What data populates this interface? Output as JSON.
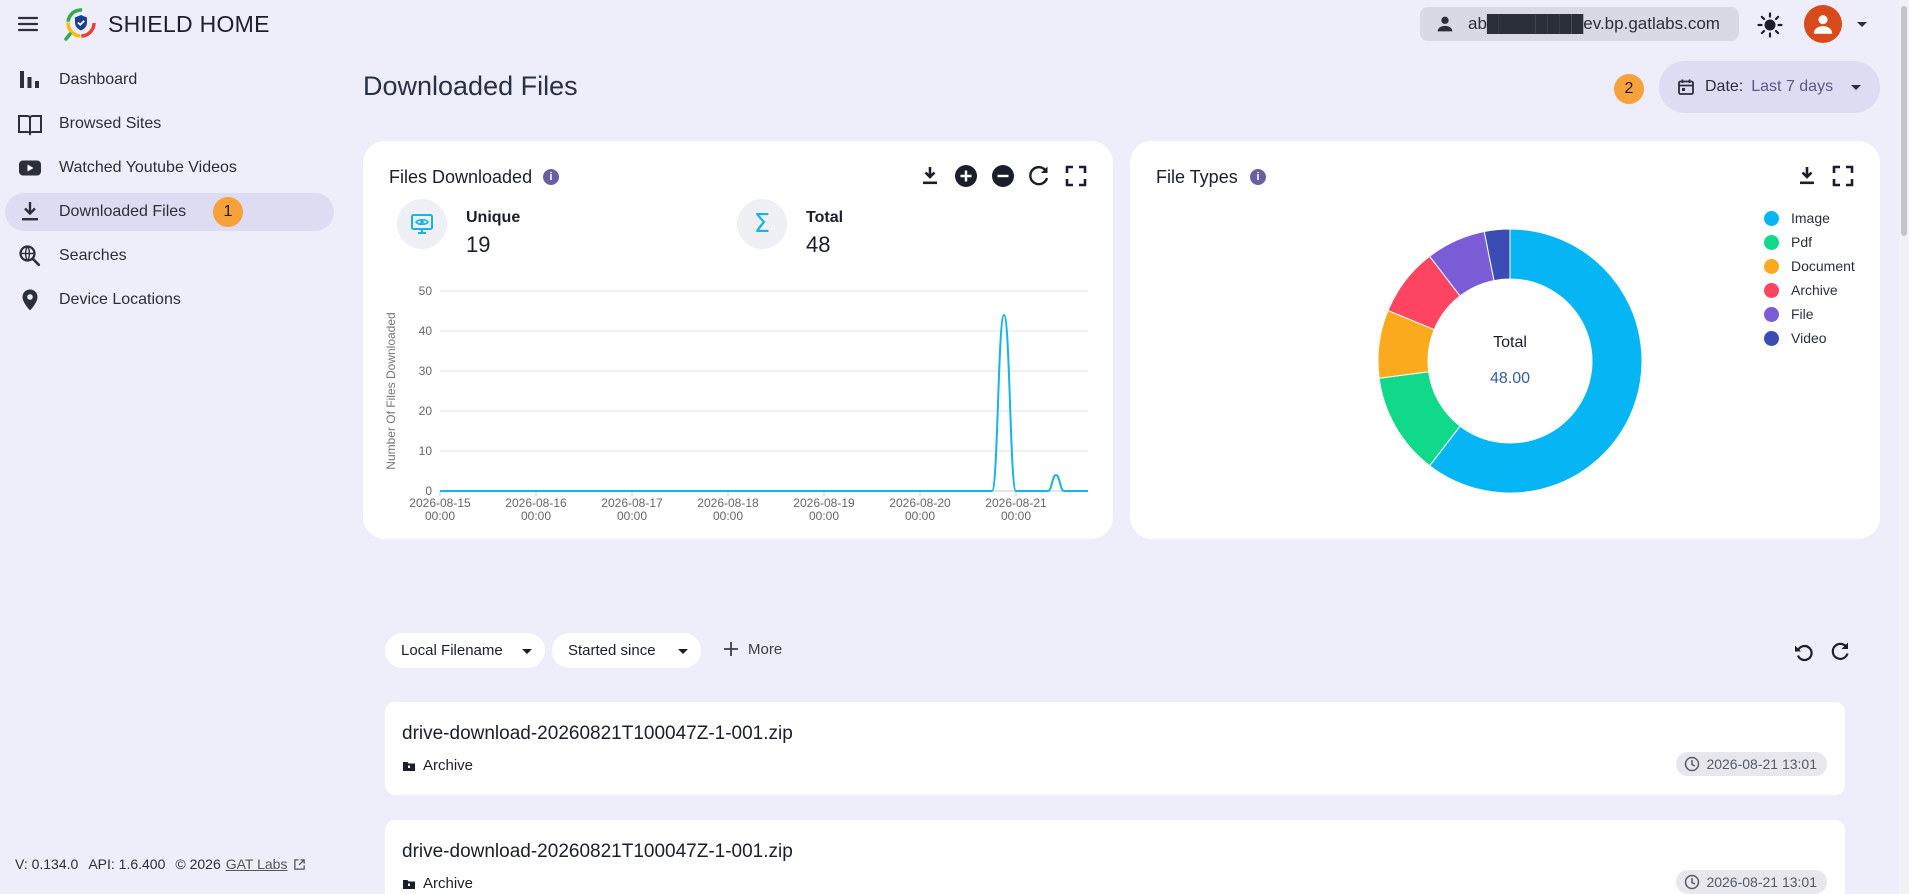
{
  "app": {
    "title": "SHIELD HOME",
    "user_email": "ab████████ev.bp.gatlabs.com"
  },
  "sidebar": {
    "items": [
      {
        "label": "Dashboard",
        "icon": "bar-chart-icon"
      },
      {
        "label": "Browsed Sites",
        "icon": "book-open-icon"
      },
      {
        "label": "Watched Youtube Videos",
        "icon": "youtube-icon"
      },
      {
        "label": "Downloaded Files",
        "icon": "download-icon",
        "active": true,
        "badge": "1"
      },
      {
        "label": "Searches",
        "icon": "search-globe-icon"
      },
      {
        "label": "Device Locations",
        "icon": "location-pin-icon"
      }
    ],
    "footer": {
      "version": "V: 0.134.0",
      "api": "API: 1.6.400",
      "copyright": "© 2026",
      "company_link": "GAT Labs"
    }
  },
  "page": {
    "title": "Downloaded Files",
    "date_filter": {
      "badge": "2",
      "label": "Date:",
      "value": "Last 7 days"
    }
  },
  "files_card": {
    "title": "Files Downloaded",
    "info": "i",
    "stats": {
      "unique_label": "Unique",
      "unique_value": "19",
      "total_label": "Total",
      "total_value": "48"
    }
  },
  "types_card": {
    "title": "File Types",
    "info": "i",
    "center_label": "Total",
    "center_value": "48.00"
  },
  "chart_data": [
    {
      "type": "line",
      "ylabel": "Number Of Files Downloaded",
      "xlabel": "",
      "ylim": [
        0,
        50
      ],
      "yticks": [
        0,
        10,
        20,
        30,
        40,
        50
      ],
      "xticks": [
        {
          "date": "2026-08-15",
          "time": "00:00"
        },
        {
          "date": "2026-08-16",
          "time": "00:00"
        },
        {
          "date": "2026-08-17",
          "time": "00:00"
        },
        {
          "date": "2026-08-18",
          "time": "00:00"
        },
        {
          "date": "2026-08-19",
          "time": "00:00"
        },
        {
          "date": "2026-08-20",
          "time": "00:00"
        },
        {
          "date": "2026-08-21",
          "time": "00:00"
        }
      ],
      "grid": true,
      "color": "#17b4ea",
      "points": [
        {
          "x": "2026-08-15 00:00",
          "y": 0
        },
        {
          "x": "2026-08-20 18:00",
          "y": 0
        },
        {
          "x": "2026-08-20 21:00",
          "y": 44
        },
        {
          "x": "2026-08-21 00:00",
          "y": 0
        },
        {
          "x": "2026-08-21 08:00",
          "y": 0
        },
        {
          "x": "2026-08-21 10:00",
          "y": 4
        },
        {
          "x": "2026-08-21 12:00",
          "y": 0
        },
        {
          "x": "2026-08-21 18:00",
          "y": 0
        }
      ]
    },
    {
      "type": "pie",
      "donut": true,
      "legend": "top-right",
      "slices": [
        {
          "label": "Image",
          "value": 29,
          "color": "#06b6f4"
        },
        {
          "label": "Pdf",
          "value": 6,
          "color": "#10d98a"
        },
        {
          "label": "Document",
          "value": 4,
          "color": "#fbaa1e"
        },
        {
          "label": "Archive",
          "value": 4,
          "color": "#fd4562"
        },
        {
          "label": "File",
          "value": 3.5,
          "color": "#7a5cd6"
        },
        {
          "label": "Video",
          "value": 1.5,
          "color": "#3b4db5"
        }
      ]
    }
  ],
  "filters": {
    "chips": [
      {
        "label": "Local Filename"
      },
      {
        "label": "Started since"
      }
    ],
    "more_label": "More"
  },
  "results": [
    {
      "filename": "drive-download-20260821T100047Z-1-001.zip",
      "type": "Archive",
      "time": "2026-08-21 13:01"
    },
    {
      "filename": "drive-download-20260821T100047Z-1-001.zip",
      "type": "Archive",
      "time": "2026-08-21 13:01"
    }
  ],
  "colors": {
    "background": "#eeedfa",
    "accent": "#17b4ea",
    "badge": "#f7a13a",
    "active_nav": "#dedcf2"
  }
}
